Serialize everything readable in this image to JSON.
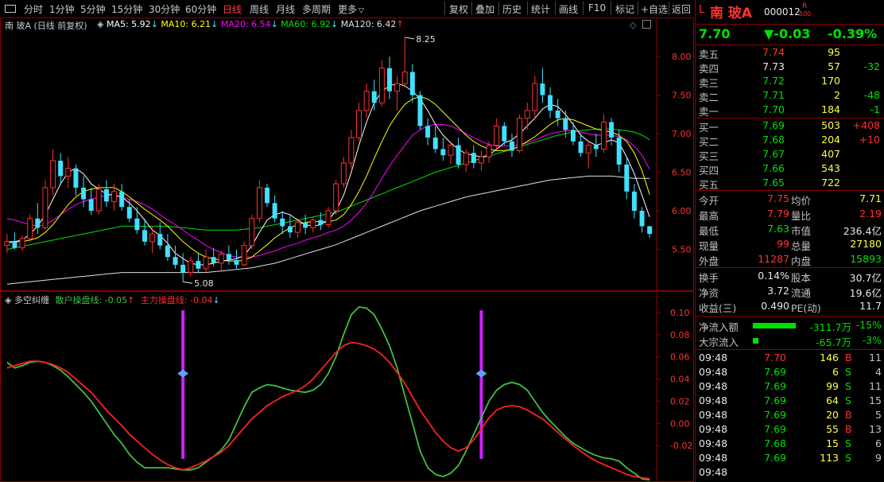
{
  "toolbar": {
    "periods": [
      "分时",
      "1分钟",
      "5分钟",
      "15分钟",
      "30分钟",
      "60分钟",
      "日线",
      "周线",
      "月线",
      "多周期",
      "更多"
    ],
    "active_period": "日线",
    "tools": [
      "复权",
      "叠加",
      "历史",
      "统计",
      "画线",
      "F10",
      "标记",
      "+自选",
      "返回"
    ]
  },
  "main_legend": {
    "name": "南 玻A (日线 前复权)",
    "ma5": "MA5: 5.92",
    "ma10": "MA10: 6.21",
    "ma20": "MA20: 6.54",
    "ma60": "MA60: 6.92",
    "ma120": "MA120: 6.42",
    "high_label": "8.25",
    "low_label": "5.08"
  },
  "price_axis": [
    "8.00",
    "7.50",
    "7.00",
    "6.50",
    "6.00",
    "5.50"
  ],
  "indicator_legend": {
    "name": "多空纠缠",
    "retail": "散户操盘线: -0.05",
    "main": "主力操盘线: -0.04"
  },
  "ind_axis": [
    "0.10",
    "0.08",
    "0.06",
    "0.04",
    "0.02",
    "0.00",
    "-0.02"
  ],
  "colors": {
    "up": "#ff3030",
    "down": "#40e0ff",
    "ma5": "#ffffff",
    "ma10": "#ffff00",
    "ma20": "#ff00ff",
    "ma60": "#00e000",
    "ma120": "#e0e0e0",
    "retail_line": "#40c040",
    "main_line": "#ff2020",
    "signal": "#d020ff"
  },
  "chart_data": {
    "type": "candlestick",
    "yrange": [
      5.0,
      8.3
    ],
    "candles": [
      [
        5.55,
        5.7,
        5.45,
        5.6
      ],
      [
        5.6,
        5.72,
        5.5,
        5.52
      ],
      [
        5.52,
        5.68,
        5.48,
        5.64
      ],
      [
        5.64,
        5.95,
        5.6,
        5.9
      ],
      [
        5.9,
        6.1,
        5.7,
        5.78
      ],
      [
        5.78,
        6.4,
        5.75,
        6.3
      ],
      [
        6.3,
        6.8,
        6.2,
        6.65
      ],
      [
        6.65,
        6.75,
        6.35,
        6.45
      ],
      [
        6.45,
        6.7,
        6.3,
        6.55
      ],
      [
        6.55,
        6.6,
        6.2,
        6.3
      ],
      [
        6.3,
        6.45,
        6.05,
        6.15
      ],
      [
        6.15,
        6.3,
        5.95,
        6.0
      ],
      [
        6.0,
        6.35,
        5.95,
        6.28
      ],
      [
        6.28,
        6.4,
        6.05,
        6.12
      ],
      [
        6.12,
        6.35,
        6.0,
        6.25
      ],
      [
        6.25,
        6.35,
        6.0,
        6.05
      ],
      [
        6.05,
        6.15,
        5.85,
        5.9
      ],
      [
        5.9,
        6.05,
        5.7,
        5.75
      ],
      [
        5.75,
        5.9,
        5.55,
        5.6
      ],
      [
        5.6,
        5.8,
        5.45,
        5.7
      ],
      [
        5.7,
        5.85,
        5.5,
        5.55
      ],
      [
        5.55,
        5.7,
        5.35,
        5.4
      ],
      [
        5.4,
        5.55,
        5.25,
        5.3
      ],
      [
        5.3,
        5.45,
        5.08,
        5.2
      ],
      [
        5.2,
        5.4,
        5.15,
        5.35
      ],
      [
        5.35,
        5.45,
        5.2,
        5.25
      ],
      [
        5.25,
        5.5,
        5.2,
        5.4
      ],
      [
        5.4,
        5.52,
        5.28,
        5.32
      ],
      [
        5.32,
        5.48,
        5.22,
        5.44
      ],
      [
        5.44,
        5.55,
        5.3,
        5.36
      ],
      [
        5.36,
        5.5,
        5.25,
        5.3
      ],
      [
        5.3,
        5.6,
        5.28,
        5.55
      ],
      [
        5.55,
        5.95,
        5.5,
        5.9
      ],
      [
        5.9,
        6.4,
        5.85,
        6.3
      ],
      [
        6.3,
        6.35,
        6.05,
        6.1
      ],
      [
        6.1,
        6.2,
        5.85,
        5.9
      ],
      [
        5.9,
        6.0,
        5.7,
        5.8
      ],
      [
        5.8,
        5.95,
        5.65,
        5.72
      ],
      [
        5.72,
        5.9,
        5.65,
        5.85
      ],
      [
        5.85,
        5.95,
        5.7,
        5.78
      ],
      [
        5.78,
        5.92,
        5.72,
        5.88
      ],
      [
        5.88,
        5.98,
        5.75,
        5.82
      ],
      [
        5.82,
        6.05,
        5.78,
        6.0
      ],
      [
        6.0,
        6.4,
        5.95,
        6.35
      ],
      [
        6.35,
        6.7,
        6.3,
        6.62
      ],
      [
        6.62,
        7.05,
        6.55,
        6.95
      ],
      [
        6.95,
        7.4,
        6.9,
        7.3
      ],
      [
        7.3,
        7.65,
        7.2,
        7.55
      ],
      [
        7.55,
        7.7,
        7.3,
        7.4
      ],
      [
        7.4,
        7.95,
        7.35,
        7.85
      ],
      [
        7.85,
        8.0,
        7.45,
        7.55
      ],
      [
        7.55,
        7.75,
        7.3,
        7.65
      ],
      [
        7.65,
        8.25,
        7.6,
        7.8
      ],
      [
        7.8,
        7.9,
        7.4,
        7.5
      ],
      [
        7.5,
        7.55,
        7.05,
        7.1
      ],
      [
        7.1,
        7.2,
        6.85,
        6.95
      ],
      [
        6.95,
        7.1,
        6.75,
        6.8
      ],
      [
        6.8,
        6.95,
        6.65,
        6.72
      ],
      [
        6.72,
        6.9,
        6.6,
        6.85
      ],
      [
        6.85,
        6.95,
        6.55,
        6.6
      ],
      [
        6.6,
        6.8,
        6.5,
        6.75
      ],
      [
        6.75,
        6.85,
        6.55,
        6.62
      ],
      [
        6.62,
        6.78,
        6.52,
        6.7
      ],
      [
        6.7,
        6.9,
        6.62,
        6.85
      ],
      [
        6.85,
        7.2,
        6.8,
        7.1
      ],
      [
        7.1,
        7.15,
        6.85,
        6.9
      ],
      [
        6.9,
        7.0,
        6.7,
        6.78
      ],
      [
        6.78,
        7.25,
        6.75,
        7.2
      ],
      [
        7.2,
        7.4,
        7.05,
        7.3
      ],
      [
        7.3,
        7.75,
        7.2,
        7.65
      ],
      [
        7.65,
        7.85,
        7.4,
        7.5
      ],
      [
        7.5,
        7.6,
        7.2,
        7.3
      ],
      [
        7.3,
        7.45,
        7.1,
        7.2
      ],
      [
        7.2,
        7.3,
        6.95,
        7.05
      ],
      [
        7.05,
        7.15,
        6.85,
        6.9
      ],
      [
        6.9,
        7.0,
        6.7,
        6.75
      ],
      [
        6.75,
        6.9,
        6.55,
        6.85
      ],
      [
        6.85,
        7.0,
        6.7,
        6.8
      ],
      [
        6.8,
        7.25,
        6.75,
        7.15
      ],
      [
        7.15,
        7.2,
        6.85,
        6.95
      ],
      [
        6.95,
        7.05,
        6.5,
        6.6
      ],
      [
        6.6,
        6.7,
        6.15,
        6.25
      ],
      [
        6.25,
        6.35,
        5.9,
        6.0
      ],
      [
        6.0,
        6.05,
        5.72,
        5.8
      ],
      [
        5.8,
        5.8,
        5.65,
        5.7
      ]
    ],
    "ma5": [
      5.58,
      5.6,
      5.62,
      5.7,
      5.8,
      5.95,
      6.15,
      6.35,
      6.5,
      6.55,
      6.48,
      6.35,
      6.28,
      6.22,
      6.2,
      6.18,
      6.1,
      6.0,
      5.88,
      5.75,
      5.68,
      5.58,
      5.45,
      5.38,
      5.32,
      5.3,
      5.3,
      5.32,
      5.35,
      5.36,
      5.38,
      5.42,
      5.55,
      5.72,
      5.88,
      5.95,
      5.98,
      5.95,
      5.88,
      5.82,
      5.8,
      5.82,
      5.88,
      6.0,
      6.2,
      6.5,
      6.85,
      7.15,
      7.4,
      7.55,
      7.62,
      7.65,
      7.62,
      7.55,
      7.45,
      7.3,
      7.12,
      6.98,
      6.88,
      6.8,
      6.74,
      6.72,
      6.7,
      6.72,
      6.8,
      6.88,
      6.92,
      7.0,
      7.1,
      7.2,
      7.32,
      7.38,
      7.35,
      7.25,
      7.12,
      6.98,
      6.9,
      6.85,
      6.88,
      6.92,
      6.88,
      6.7,
      6.48,
      6.2,
      5.92
    ],
    "ma10": [
      5.6,
      5.6,
      5.6,
      5.62,
      5.65,
      5.72,
      5.82,
      5.95,
      6.08,
      6.18,
      6.25,
      6.28,
      6.3,
      6.3,
      6.3,
      6.25,
      6.18,
      6.1,
      6.02,
      5.95,
      5.88,
      5.8,
      5.7,
      5.6,
      5.52,
      5.45,
      5.4,
      5.38,
      5.36,
      5.35,
      5.35,
      5.36,
      5.4,
      5.48,
      5.56,
      5.65,
      5.72,
      5.78,
      5.82,
      5.85,
      5.86,
      5.86,
      5.86,
      5.88,
      5.95,
      6.08,
      6.25,
      6.45,
      6.68,
      6.9,
      7.1,
      7.25,
      7.38,
      7.45,
      7.48,
      7.45,
      7.38,
      7.28,
      7.18,
      7.08,
      6.98,
      6.9,
      6.84,
      6.8,
      6.78,
      6.78,
      6.8,
      6.84,
      6.9,
      6.96,
      7.04,
      7.12,
      7.18,
      7.2,
      7.18,
      7.14,
      7.1,
      7.06,
      7.04,
      7.02,
      6.98,
      6.9,
      6.75,
      6.52,
      6.21
    ],
    "ma20": [
      5.9,
      5.88,
      5.85,
      5.82,
      5.8,
      5.82,
      5.88,
      5.95,
      6.02,
      6.08,
      6.12,
      6.15,
      6.18,
      6.2,
      6.2,
      6.18,
      6.15,
      6.12,
      6.08,
      6.02,
      5.95,
      5.88,
      5.82,
      5.75,
      5.68,
      5.62,
      5.55,
      5.5,
      5.46,
      5.42,
      5.4,
      5.4,
      5.4,
      5.42,
      5.45,
      5.48,
      5.52,
      5.55,
      5.58,
      5.62,
      5.65,
      5.68,
      5.72,
      5.75,
      5.8,
      5.88,
      5.98,
      6.1,
      6.25,
      6.42,
      6.58,
      6.72,
      6.85,
      6.98,
      7.05,
      7.1,
      7.12,
      7.12,
      7.1,
      7.05,
      7.0,
      6.95,
      6.9,
      6.86,
      6.84,
      6.84,
      6.84,
      6.86,
      6.88,
      6.92,
      6.96,
      7.0,
      7.02,
      7.04,
      7.04,
      7.02,
      7.0,
      6.98,
      6.98,
      6.98,
      6.96,
      6.92,
      6.84,
      6.72,
      6.54
    ],
    "ma60": [
      5.5,
      5.52,
      5.54,
      5.56,
      5.58,
      5.6,
      5.62,
      5.64,
      5.66,
      5.68,
      5.7,
      5.72,
      5.74,
      5.76,
      5.78,
      5.8,
      5.8,
      5.8,
      5.8,
      5.8,
      5.8,
      5.8,
      5.79,
      5.78,
      5.77,
      5.76,
      5.75,
      5.75,
      5.75,
      5.75,
      5.75,
      5.76,
      5.77,
      5.78,
      5.8,
      5.82,
      5.84,
      5.86,
      5.88,
      5.9,
      5.92,
      5.94,
      5.96,
      5.98,
      6.02,
      6.06,
      6.1,
      6.14,
      6.18,
      6.22,
      6.26,
      6.3,
      6.34,
      6.38,
      6.42,
      6.46,
      6.5,
      6.53,
      6.56,
      6.59,
      6.62,
      6.65,
      6.68,
      6.71,
      6.74,
      6.77,
      6.8,
      6.83,
      6.86,
      6.89,
      6.92,
      6.95,
      6.98,
      7.0,
      7.02,
      7.04,
      7.05,
      7.06,
      7.06,
      7.06,
      7.05,
      7.04,
      7.02,
      6.98,
      6.92
    ],
    "ma120": [
      5.05,
      5.06,
      5.07,
      5.08,
      5.09,
      5.1,
      5.11,
      5.12,
      5.13,
      5.14,
      5.15,
      5.16,
      5.17,
      5.18,
      5.19,
      5.2,
      5.2,
      5.2,
      5.2,
      5.2,
      5.2,
      5.2,
      5.2,
      5.2,
      5.2,
      5.2,
      5.2,
      5.21,
      5.22,
      5.23,
      5.24,
      5.25,
      5.26,
      5.28,
      5.3,
      5.32,
      5.35,
      5.38,
      5.41,
      5.44,
      5.47,
      5.5,
      5.53,
      5.56,
      5.6,
      5.64,
      5.68,
      5.72,
      5.76,
      5.8,
      5.84,
      5.88,
      5.92,
      5.96,
      6.0,
      6.03,
      6.06,
      6.09,
      6.12,
      6.15,
      6.18,
      6.2,
      6.22,
      6.24,
      6.26,
      6.28,
      6.3,
      6.32,
      6.34,
      6.36,
      6.38,
      6.4,
      6.41,
      6.42,
      6.43,
      6.44,
      6.45,
      6.45,
      6.45,
      6.45,
      6.44,
      6.43,
      6.42,
      6.42,
      6.42
    ],
    "ind_yrange": [
      -0.05,
      0.115
    ],
    "retail": [
      0.055,
      0.05,
      0.052,
      0.055,
      0.056,
      0.055,
      0.052,
      0.048,
      0.042,
      0.035,
      0.028,
      0.02,
      0.01,
      0.0,
      -0.01,
      -0.018,
      -0.028,
      -0.035,
      -0.04,
      -0.04,
      -0.04,
      -0.04,
      -0.041,
      -0.042,
      -0.042,
      -0.04,
      -0.035,
      -0.03,
      -0.024,
      -0.015,
      0.0,
      0.015,
      0.028,
      0.032,
      0.035,
      0.034,
      0.032,
      0.03,
      0.029,
      0.028,
      0.03,
      0.035,
      0.045,
      0.06,
      0.08,
      0.098,
      0.105,
      0.104,
      0.098,
      0.085,
      0.07,
      0.05,
      0.025,
      0.0,
      -0.025,
      -0.04,
      -0.046,
      -0.048,
      -0.045,
      -0.038,
      -0.025,
      -0.01,
      0.005,
      0.02,
      0.03,
      0.035,
      0.037,
      0.035,
      0.03,
      0.02,
      0.01,
      0.002,
      -0.005,
      -0.012,
      -0.018,
      -0.022,
      -0.026,
      -0.029,
      -0.031,
      -0.032,
      -0.034,
      -0.04,
      -0.045,
      -0.05,
      -0.051
    ],
    "main": [
      0.05,
      0.052,
      0.054,
      0.056,
      0.056,
      0.055,
      0.053,
      0.05,
      0.046,
      0.04,
      0.034,
      0.028,
      0.02,
      0.012,
      0.005,
      -0.002,
      -0.01,
      -0.016,
      -0.022,
      -0.028,
      -0.033,
      -0.037,
      -0.04,
      -0.042,
      -0.04,
      -0.037,
      -0.034,
      -0.03,
      -0.026,
      -0.02,
      -0.012,
      -0.004,
      0.004,
      0.01,
      0.016,
      0.02,
      0.024,
      0.027,
      0.03,
      0.034,
      0.04,
      0.048,
      0.056,
      0.064,
      0.07,
      0.073,
      0.072,
      0.07,
      0.067,
      0.062,
      0.055,
      0.046,
      0.036,
      0.024,
      0.012,
      0.002,
      -0.008,
      -0.016,
      -0.022,
      -0.025,
      -0.022,
      -0.015,
      -0.005,
      0.005,
      0.012,
      0.015,
      0.016,
      0.015,
      0.012,
      0.008,
      0.004,
      -0.002,
      -0.008,
      -0.014,
      -0.02,
      -0.025,
      -0.03,
      -0.034,
      -0.037,
      -0.04,
      -0.043,
      -0.046,
      -0.048,
      -0.049,
      -0.05
    ],
    "signals": [
      23,
      62
    ]
  },
  "quote": {
    "flag": "L",
    "name": "南 玻A",
    "code": "000012",
    "badge_top": "R",
    "badge_bottom": "500",
    "price": "7.70",
    "change": "▼-0.03",
    "pct": "-0.39%"
  },
  "orderbook": {
    "asks": [
      {
        "label": "卖五",
        "price": "7.74",
        "vol": "95",
        "chg": ""
      },
      {
        "label": "卖四",
        "price": "7.73",
        "vol": "57",
        "chg": "-32"
      },
      {
        "label": "卖三",
        "price": "7.72",
        "vol": "170",
        "chg": ""
      },
      {
        "label": "卖二",
        "price": "7.71",
        "vol": "2",
        "chg": "-48"
      },
      {
        "label": "卖一",
        "price": "7.70",
        "vol": "184",
        "chg": "-1"
      }
    ],
    "bids": [
      {
        "label": "买一",
        "price": "7.69",
        "vol": "503",
        "chg": "+408"
      },
      {
        "label": "买二",
        "price": "7.68",
        "vol": "204",
        "chg": "+10"
      },
      {
        "label": "买三",
        "price": "7.67",
        "vol": "407",
        "chg": ""
      },
      {
        "label": "买四",
        "price": "7.66",
        "vol": "543",
        "chg": ""
      },
      {
        "label": "买五",
        "price": "7.65",
        "vol": "722",
        "chg": ""
      }
    ]
  },
  "stats": [
    {
      "l1": "今开",
      "v1": "7.75",
      "l2": "均价",
      "v2": "7.71"
    },
    {
      "l1": "最高",
      "v1": "7.79",
      "l2": "量比",
      "v2": "2.19"
    },
    {
      "l1": "最低",
      "v1": "7.63",
      "l2": "市值",
      "v2": "236.4亿"
    },
    {
      "l1": "现量",
      "v1": "99",
      "l2": "总量",
      "v2": "27180"
    },
    {
      "l1": "外盘",
      "v1": "11287",
      "l2": "内盘",
      "v2": "15893"
    }
  ],
  "fundamentals": [
    {
      "l1": "换手",
      "v1": "0.14%",
      "l2": "股本",
      "v2": "30.7亿"
    },
    {
      "l1": "净资",
      "v1": "3.72",
      "l2": "流通",
      "v2": "19.6亿"
    },
    {
      "l1": "收益(三)",
      "v1": "0.490",
      "l2": "PE(动)",
      "v2": "11.7"
    }
  ],
  "flows": [
    {
      "label": "净流入额",
      "value": "-311.7万",
      "pct": "-15%",
      "bar": 0.8
    },
    {
      "label": "大宗流入",
      "value": "-65.7万",
      "pct": "-3%",
      "bar": 0.1
    }
  ],
  "ticks": [
    {
      "t": "09:48",
      "p": "7.70",
      "v": "146",
      "s": "B",
      "n": "11"
    },
    {
      "t": "09:48",
      "p": "7.69",
      "v": "6",
      "s": "S",
      "n": "4"
    },
    {
      "t": "09:48",
      "p": "7.69",
      "v": "99",
      "s": "S",
      "n": "11"
    },
    {
      "t": "09:48",
      "p": "7.69",
      "v": "64",
      "s": "S",
      "n": "15"
    },
    {
      "t": "09:48",
      "p": "7.69",
      "v": "20",
      "s": "B",
      "n": "5"
    },
    {
      "t": "09:48",
      "p": "7.69",
      "v": "55",
      "s": "B",
      "n": "13"
    },
    {
      "t": "09:48",
      "p": "7.68",
      "v": "15",
      "s": "S",
      "n": "6"
    },
    {
      "t": "09:48",
      "p": "7.69",
      "v": "113",
      "s": "S",
      "n": "9"
    },
    {
      "t": "09:48",
      "p": "",
      "v": "",
      "s": "",
      "n": ""
    }
  ]
}
